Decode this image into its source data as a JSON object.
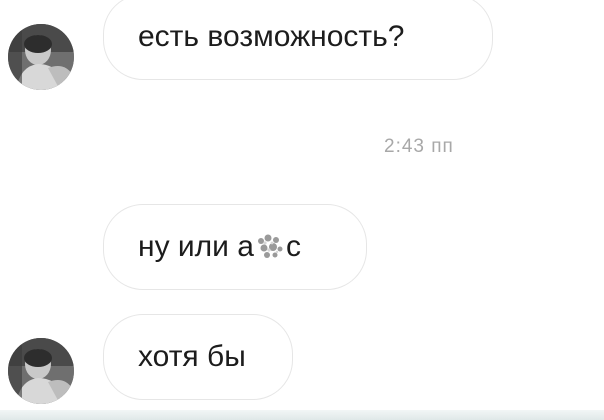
{
  "messages": [
    {
      "text": "есть возможность?"
    },
    {
      "text_before": "ну или а",
      "text_after": "с"
    },
    {
      "text": "хотя бы"
    }
  ],
  "timestamp": "2:43 пп",
  "icons": {
    "avatar": "profile-photo",
    "censor": "scribble-blur"
  },
  "colors": {
    "background": "#ffffff",
    "bubble_border": "#e6e6e6",
    "text": "#1c1c1c",
    "timestamp": "#a8a8a8"
  }
}
